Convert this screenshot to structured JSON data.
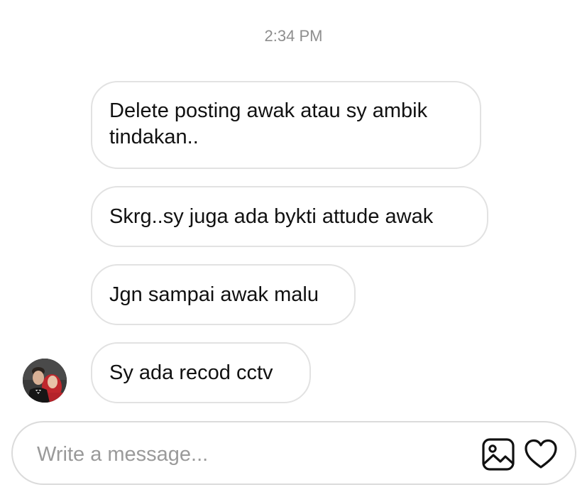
{
  "timestamp": "2:34 PM",
  "messages": [
    {
      "text": "Delete posting awak atau sy ambik tindakan.."
    },
    {
      "text": "Skrg..sy juga ada bykti attude awak"
    },
    {
      "text": "Jgn sampai awak malu"
    },
    {
      "text": "Sy ada recod cctv"
    }
  ],
  "composer": {
    "placeholder": "Write a message...",
    "image_icon": "image-icon",
    "heart_icon": "heart-icon"
  },
  "avatar": {
    "icon": "profile-avatar"
  }
}
